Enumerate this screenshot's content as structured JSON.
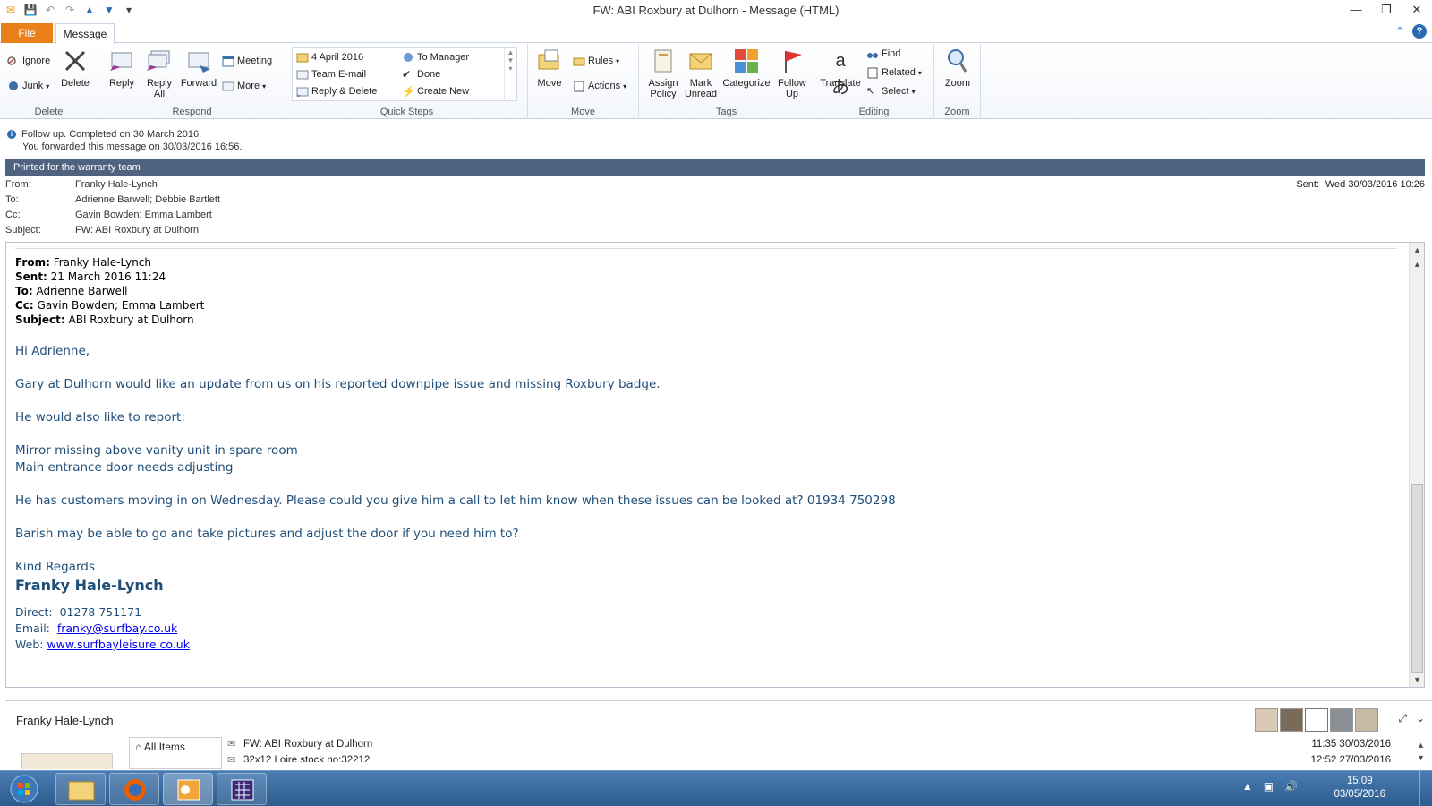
{
  "window": {
    "title": "FW: ABI Roxbury at Dulhorn  -  Message (HTML)",
    "controls": [
      "—",
      "❐",
      "✕"
    ]
  },
  "qat": {
    "icons": [
      "mail-icon",
      "save-icon",
      "undo-icon",
      "redo-icon",
      "up-arrow-icon",
      "down-arrow-icon",
      "customize-icon"
    ]
  },
  "tabs": {
    "file": "File",
    "message": "Message"
  },
  "ribbon": {
    "delete": {
      "group": "Delete",
      "ignore": "Ignore",
      "junk": "Junk",
      "delete": "Delete"
    },
    "respond": {
      "group": "Respond",
      "reply": "Reply",
      "reply_all_1": "Reply",
      "reply_all_2": "All",
      "forward": "Forward",
      "meeting": "Meeting",
      "more": "More"
    },
    "quick_steps": {
      "group": "Quick Steps",
      "items": [
        "4 April 2016",
        "To Manager",
        "Team E-mail",
        "Done",
        "Reply & Delete",
        "Create New"
      ]
    },
    "move": {
      "group": "Move",
      "move": "Move",
      "rules": "Rules",
      "actions": "Actions"
    },
    "tags": {
      "group": "Tags",
      "assign_1": "Assign",
      "assign_2": "Policy",
      "mark_1": "Mark",
      "mark_2": "Unread",
      "categorize": "Categorize",
      "follow_1": "Follow",
      "follow_2": "Up"
    },
    "editing": {
      "group": "Editing",
      "translate": "Translate",
      "find": "Find",
      "related": "Related",
      "select": "Select"
    },
    "zoom": {
      "group": "Zoom",
      "zoom": "Zoom"
    }
  },
  "info": {
    "line1": "Follow up.  Completed on 30 March 2016.",
    "line2": "You forwarded this message on 30/03/2016 16:56."
  },
  "printed_bar": "Printed for the warranty team",
  "header": {
    "from_label": "From:",
    "from": "Franky Hale-Lynch",
    "to_label": "To:",
    "to": "Adrienne Barwell; Debbie Bartlett",
    "cc_label": "Cc:",
    "cc": "Gavin Bowden; Emma Lambert",
    "subject_label": "Subject:",
    "subject": "FW: ABI Roxbury at Dulhorn",
    "sent_label": "Sent:",
    "sent": "Wed 30/03/2016 10:26"
  },
  "forwarded": {
    "from_label": "From:",
    "from": " Franky Hale-Lynch",
    "sent_label": "Sent:",
    "sent": " 21 March 2016 11:24",
    "to_label": "To:",
    "to": " Adrienne Barwell",
    "cc_label": "Cc:",
    "cc": " Gavin Bowden; Emma Lambert",
    "subject_label": "Subject:",
    "subject": " ABI Roxbury at Dulhorn"
  },
  "body": {
    "greeting": "Hi Adrienne,",
    "p1": "Gary at Dulhorn would like an update from us on his reported downpipe issue and missing Roxbury badge.",
    "p2": "He would also like to report:",
    "item1": "Mirror missing above vanity unit in spare room",
    "item2": "Main entrance door needs adjusting",
    "p3": "He has customers moving in on Wednesday. Please could you give him a call to let him know when these issues can be looked at? 01934 750298",
    "p4": "Barish may be able to go and take pictures and adjust the door if you need him to?",
    "closing": "Kind Regards",
    "sig_name": "Franky Hale-Lynch",
    "direct_label": "Direct:",
    "direct": "01278 751171",
    "email_label": "Email:",
    "email": "franky@surfbay.co.uk",
    "web_label": "Web:",
    "web": "www.surfbayleisure.co.uk"
  },
  "people": {
    "name": "Franky Hale-Lynch",
    "nav_all": "All Items",
    "items": [
      {
        "subject": "FW: ABI Roxbury at Dulhorn",
        "time": "11:35  30/03/2016"
      },
      {
        "subject": "32x12 Loire stock no:32212",
        "time": "12:52  27/03/2016"
      }
    ]
  },
  "taskbar": {
    "time": "15:09",
    "date": "03/05/2016"
  }
}
